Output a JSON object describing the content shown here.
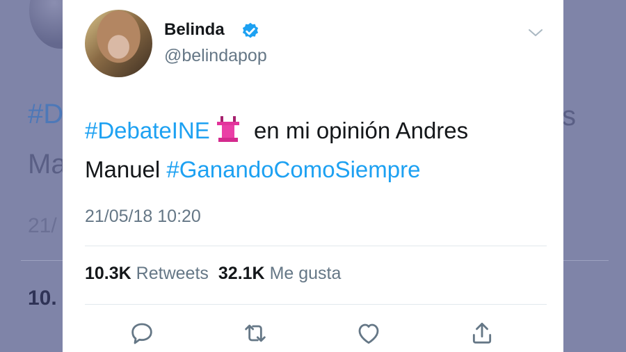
{
  "background": {
    "hashtag_fragment": "#D",
    "letter_fragment": "s",
    "name_fragment": "Ma",
    "date_fragment": "21/",
    "count_fragment": "10."
  },
  "tweet": {
    "author_name": "Belinda",
    "author_handle": "@belindapop",
    "verified": true,
    "text_parts": {
      "hashtag_1": "#DebateINE",
      "emoji": "podium",
      "text_1": " en mi opinión Andres Manuel ",
      "hashtag_2": "#GanandoComoSiempre"
    },
    "timestamp": "21/05/18 10:20",
    "retweet_count": "10.3K",
    "retweet_label": "Retweets",
    "like_count": "32.1K",
    "like_label": "Me gusta"
  },
  "icons": {
    "reply": "reply-icon",
    "retweet": "retweet-icon",
    "like": "heart-icon",
    "share": "share-icon",
    "more": "chevron-down-icon",
    "verified": "verified-badge-icon"
  },
  "colors": {
    "link": "#1da1f2",
    "verified": "#1da1f2",
    "text": "#14171a",
    "secondary": "#657786",
    "backdrop": "#7f84a8"
  }
}
